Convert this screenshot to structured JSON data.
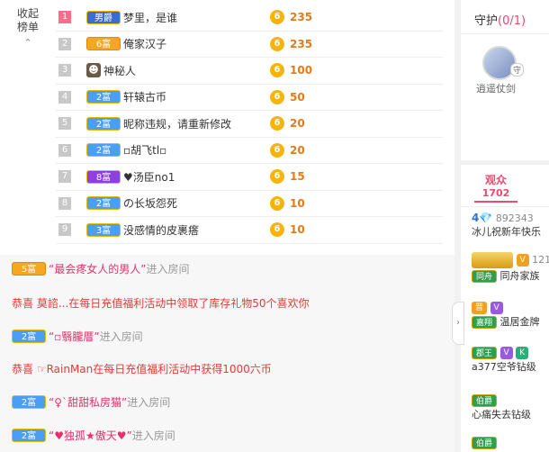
{
  "collapse": {
    "label_line1": "收起",
    "label_line2": "榜单",
    "chevron": "⌃"
  },
  "ranking": [
    {
      "rank": "1",
      "badge": "男爵",
      "badge_type": "male",
      "name": "梦里，是谁",
      "coin": "6",
      "value": "235"
    },
    {
      "rank": "2",
      "badge": "6富",
      "badge_type": "gold",
      "name": "俺家汉子",
      "coin": "6",
      "value": "235"
    },
    {
      "rank": "3",
      "badge": "",
      "badge_type": "avatar",
      "name": "神秘人",
      "coin": "6",
      "value": "100"
    },
    {
      "rank": "4",
      "badge": "2富",
      "badge_type": "blue",
      "name": "轩辕古币",
      "coin": "6",
      "value": "50"
    },
    {
      "rank": "5",
      "badge": "2富",
      "badge_type": "blue",
      "name": "昵称违规，请重新修改",
      "coin": "6",
      "value": "20"
    },
    {
      "rank": "6",
      "badge": "2富",
      "badge_type": "blue",
      "name": "▫胡飞tl▫",
      "coin": "6",
      "value": "20"
    },
    {
      "rank": "7",
      "badge": "8富",
      "badge_type": "purple",
      "name": "♥汤臣no1",
      "coin": "6",
      "value": "15"
    },
    {
      "rank": "8",
      "badge": "2富",
      "badge_type": "blue",
      "name": "の长坂怨死",
      "coin": "6",
      "value": "10"
    },
    {
      "rank": "9",
      "badge": "3富",
      "badge_type": "blue",
      "name": "没感情的皮裹瘩",
      "coin": "6",
      "value": "10"
    }
  ],
  "chat": [
    {
      "badge": "5富",
      "badge_type": "gold",
      "user": "“最会疼女人的男人”",
      "text": "进入房间",
      "style": "enter"
    },
    {
      "badge": "",
      "badge_type": "",
      "user": "恭喜 莫諮...",
      "text": "在每日充值福利活动中领取了库存礼物50个喜欢你",
      "style": "gift"
    },
    {
      "badge": "2富",
      "badge_type": "blue",
      "user": "“▫翳朧厝”",
      "text": "进入房间",
      "style": "enter"
    },
    {
      "badge": "",
      "badge_type": "",
      "user": "恭喜 ☞RainMan",
      "text": "在每日充值福利活动中获得1000六币",
      "style": "gift"
    },
    {
      "badge": "2富",
      "badge_type": "blue",
      "user": "“♀`甜甜私房猫”",
      "text": "进入房间",
      "style": "enter"
    },
    {
      "badge": "2富",
      "badge_type": "blue",
      "user": "“♥独孤★傲天♥”",
      "text": "进入房间",
      "style": "enter"
    }
  ],
  "guard": {
    "title": "守护",
    "count": "(0/1)",
    "member_name": "逍遥仗剑",
    "lock": "守"
  },
  "audience": {
    "tab_label": "观众",
    "count": "1702",
    "items": [
      {
        "level": "4",
        "id": "892343",
        "name": "冰儿祝新年快乐"
      },
      {
        "badge1": "同舟",
        "badge2": "V",
        "extra": "121",
        "name": "同舟家族"
      },
      {
        "badge1": "嘉翔",
        "badge2": "晋",
        "badge3": "V",
        "name": "温居金牌"
      },
      {
        "badge1": "郡王",
        "badge2": "V",
        "badge3": "K",
        "name": "a377空爷钻级"
      },
      {
        "badge1": "伯爵",
        "name": "心痛失去钻级"
      },
      {
        "badge1": "伯爵",
        "name": ""
      }
    ]
  },
  "colors": {
    "accent": "#e84a72",
    "coin": "#f6b40a",
    "value": "#e17b1a"
  },
  "side_arrow": "›"
}
